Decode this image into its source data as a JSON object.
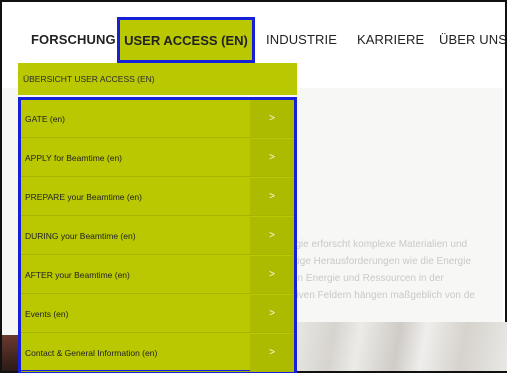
{
  "nav": {
    "items": [
      {
        "label": "FORSCHUNG"
      },
      {
        "label": "USER ACCESS (EN)"
      },
      {
        "label": "INDUSTRIE"
      },
      {
        "label": "KARRIERE"
      },
      {
        "label": "ÜBER UNS"
      }
    ],
    "active_index": 1
  },
  "dropdown": {
    "header": "ÜBERSICHT USER ACCESS (EN)",
    "items": [
      {
        "label": "GATE (en)"
      },
      {
        "label": "APPLY for Beamtime (en)"
      },
      {
        "label": "PREPARE your Beamtime (en)"
      },
      {
        "label": "DURING your Beamtime (en)"
      },
      {
        "label": "AFTER your Beamtime (en)"
      },
      {
        "label": "Events (en)"
      },
      {
        "label": "Contact & General Information (en)"
      }
    ],
    "arrow_glyph": ">"
  },
  "background_text": [
    "rgie erforscht komplexe Materialien und",
    "ftige Herausforderungen wie die Energie",
    "on Energie und Ressourcen in der",
    "lliven Feldern hängen maßgeblich von de"
  ],
  "colors": {
    "menu_green": "#b9c800",
    "arrow_green": "#acba00",
    "highlight_blue": "#1520d8"
  }
}
